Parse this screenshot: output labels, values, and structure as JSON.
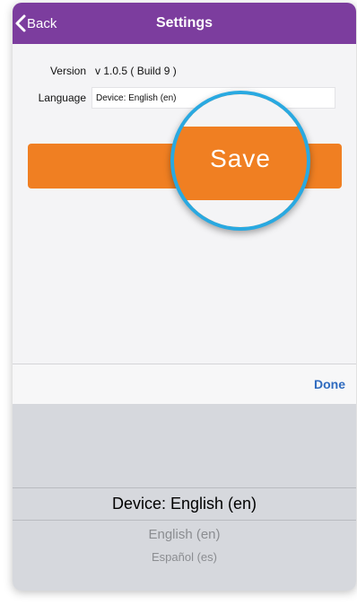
{
  "nav": {
    "back_label": "Back",
    "title": "Settings"
  },
  "settings": {
    "version_label": "Version",
    "version_value": "v 1.0.5 ( Build 9 )",
    "language_label": "Language",
    "language_value": "Device: English (en)"
  },
  "save": {
    "label": "Save",
    "color": "#f07f22"
  },
  "magnifier": {
    "label": "Save",
    "ring_color": "#29a9e1"
  },
  "toolbar": {
    "done_label": "Done"
  },
  "picker": {
    "selected": "Device: English (en)",
    "options": [
      "English (en)",
      "Español (es)"
    ]
  },
  "colors": {
    "nav_bar": "#7c3d9e",
    "accent": "#f07f22",
    "done": "#2f6bbf"
  }
}
